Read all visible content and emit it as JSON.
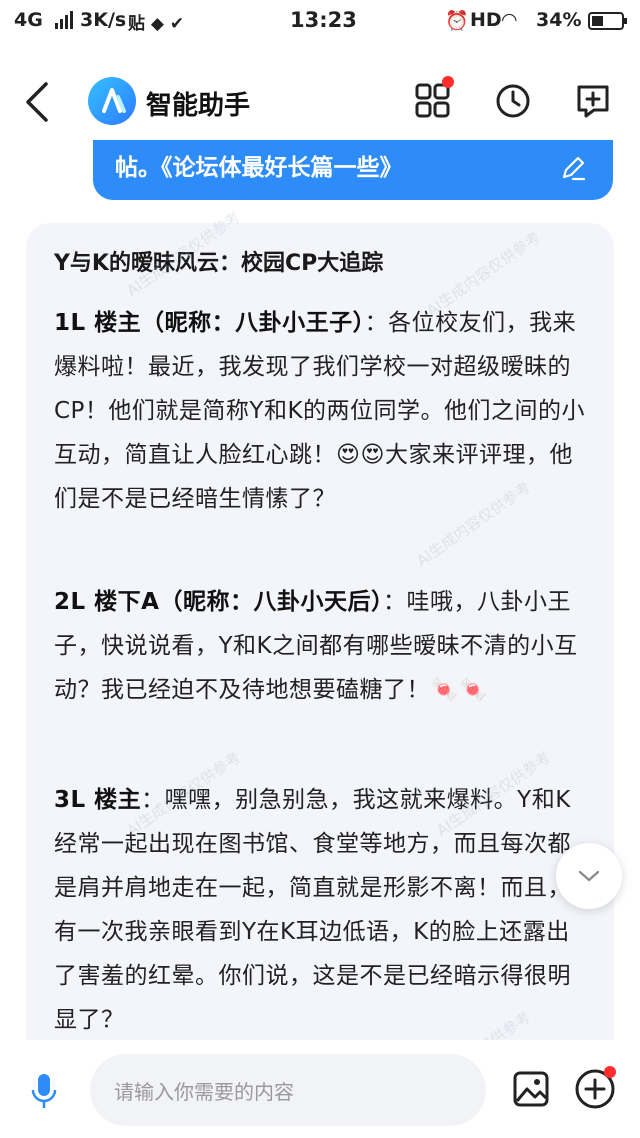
{
  "status_bar": {
    "network": "4G",
    "speed": "3K/s",
    "time": "13:23",
    "hd": "HD",
    "battery": "34%"
  },
  "header": {
    "title": "智能助手",
    "icons": [
      "apps-grid-icon",
      "history-clock-icon",
      "new-chat-icon"
    ]
  },
  "user_message": {
    "text": "帖。《论坛体最好长篇一些》"
  },
  "assistant": {
    "title": "Y与K的暧昧风云：校园CP大追踪",
    "posts": [
      {
        "floor": "1L 楼主（昵称：八卦小王子）",
        "body": "：各位校友们，我来爆料啦！最近，我发现了我们学校一对超级暧昧的CP！他们就是简称Y和K的两位同学。他们之间的小互动，简直让人脸红心跳！😍😍大家来评评理，他们是不是已经暗生情愫了？"
      },
      {
        "floor": "2L 楼下A（昵称：八卦小天后）",
        "body": "：哇哦，八卦小王子，快说说看，Y和K之间都有哪些暧昧不清的小互动？我已经迫不及待地想要磕糖了！🍬🍬"
      },
      {
        "floor": "3L 楼主",
        "body": "：嘿嘿，别急别急，我这就来爆料。Y和K经常一起出现在图书馆、食堂等地方，而且每次都是肩并肩地走在一起，简直就是形影不离！而且，有一次我亲眼看到Y在K耳边低语，K的脸上还露出了害羞的红晕。你们说，这是不是已经暗示得很明显了？"
      }
    ],
    "watermark": "AI生成内容仅供参考"
  },
  "input": {
    "placeholder": "请输入你需要的内容"
  },
  "colors": {
    "accent": "#2e8cf8",
    "card_bg": "#f3f5fa",
    "badge": "#ff2d2d"
  }
}
